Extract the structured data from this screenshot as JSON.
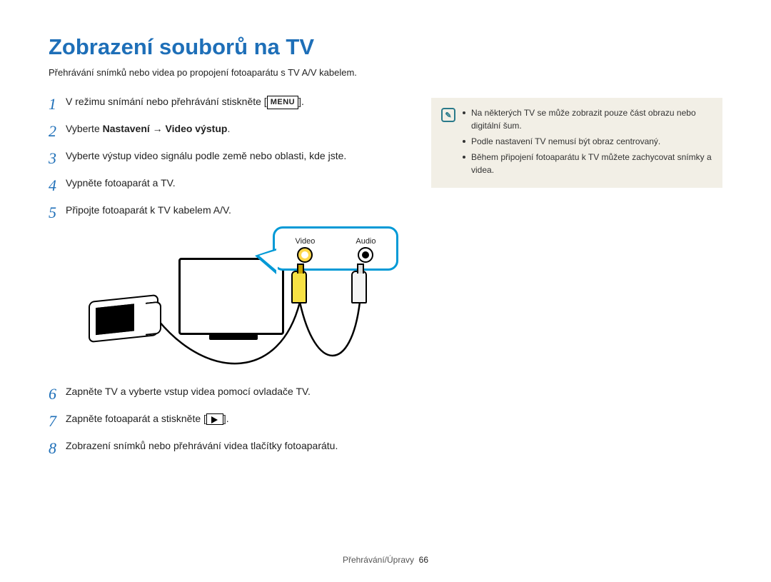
{
  "title": "Zobrazení souborů na TV",
  "subtitle": "Přehrávání snímků nebo videa po propojení fotoaparátu s TV A/V kabelem.",
  "steps": {
    "s1_a": "V režimu snímání nebo přehrávání stiskněte [",
    "s1_menu": "MENU",
    "s1_b": "].",
    "s2_a": "Vyberte ",
    "s2_bold": "Nastavení → Video výstup",
    "s2_b": ".",
    "s3": "Vyberte výstup video signálu podle země nebo oblasti, kde jste.",
    "s4": "Vypněte fotoaparát a TV.",
    "s5": "Připojte fotoaparát k TV kabelem A/V.",
    "s6": "Zapněte TV a vyberte vstup videa pomocí ovladače TV.",
    "s7_a": "Zapněte fotoaparát a stiskněte [",
    "s7_b": "].",
    "s8": "Zobrazení snímků nebo přehrávání videa tlačítky fotoaparátu."
  },
  "diagram": {
    "video_label": "Video",
    "audio_label": "Audio"
  },
  "notes": {
    "n1": "Na některých TV se může zobrazit pouze část obrazu nebo digitální šum.",
    "n2": "Podle nastavení TV nemusí být obraz centrovaný.",
    "n3": "Během připojení fotoaparátu k TV můžete zachycovat snímky a videa."
  },
  "footer": {
    "section": "Přehrávání/Úpravy",
    "page": "66"
  },
  "note_icon_glyph": "✎"
}
